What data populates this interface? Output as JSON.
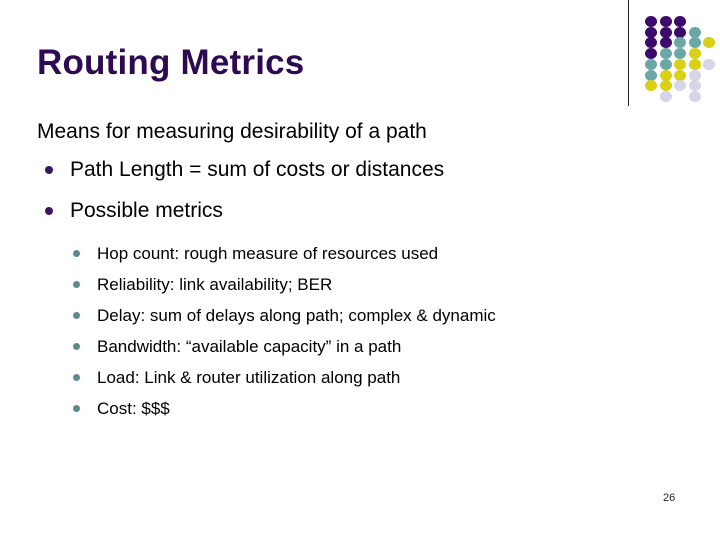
{
  "slide": {
    "title": "Routing Metrics",
    "page_number": "26",
    "title_color": "#2d0a52",
    "body_color": "#000000",
    "background_color": "#ffffff"
  },
  "content": {
    "lead": "Means for measuring desirability of a path",
    "level2": [
      {
        "text": "Path Length = sum of costs or distances",
        "bullet": "filled-circle-bullet",
        "bullet_color": "#3b145e"
      },
      {
        "text": "Possible metrics",
        "bullet": "filled-circle-bullet",
        "bullet_color": "#3b145e"
      }
    ],
    "level3": [
      {
        "text": "Hop count:  rough measure of resources used",
        "bullet": "filled-circle-bullet",
        "bullet_color": "#5c8a8a"
      },
      {
        "text": "Reliability:  link availability; BER",
        "bullet": "filled-circle-bullet",
        "bullet_color": "#5c8a8a"
      },
      {
        "text": "Delay:  sum of delays along path;  complex & dynamic",
        "bullet": "filled-circle-bullet",
        "bullet_color": "#5c8a8a"
      },
      {
        "text": "Bandwidth:  “available capacity” in a path",
        "bullet": "filled-circle-bullet",
        "bullet_color": "#5c8a8a"
      },
      {
        "text": "Load:  Link & router utilization along path",
        "bullet": "filled-circle-bullet",
        "bullet_color": "#5c8a8a"
      },
      {
        "text": "Cost:  $$$",
        "bullet": "filled-circle-bullet",
        "bullet_color": "#5c8a8a"
      }
    ]
  },
  "decoration": {
    "rule_color": "#231f20",
    "palette": {
      "purple": "#3b0a6b",
      "teal": "#6aa8a8",
      "yellow": "#d9d017",
      "lavender": "#d5d5e8"
    },
    "dots": [
      {
        "col": 0,
        "row": 0,
        "color": "#3b0a6b"
      },
      {
        "col": 1,
        "row": 0,
        "color": "#3b0a6b"
      },
      {
        "col": 2,
        "row": 0,
        "color": "#3b0a6b"
      },
      {
        "col": 0,
        "row": 1,
        "color": "#3b0a6b"
      },
      {
        "col": 1,
        "row": 1,
        "color": "#3b0a6b"
      },
      {
        "col": 2,
        "row": 1,
        "color": "#3b0a6b"
      },
      {
        "col": 3,
        "row": 1,
        "color": "#6aa8a8"
      },
      {
        "col": 0,
        "row": 2,
        "color": "#3b0a6b"
      },
      {
        "col": 1,
        "row": 2,
        "color": "#3b0a6b"
      },
      {
        "col": 2,
        "row": 2,
        "color": "#6aa8a8"
      },
      {
        "col": 3,
        "row": 2,
        "color": "#6aa8a8"
      },
      {
        "col": 4,
        "row": 2,
        "color": "#d9d017"
      },
      {
        "col": 0,
        "row": 3,
        "color": "#3b0a6b"
      },
      {
        "col": 1,
        "row": 3,
        "color": "#6aa8a8"
      },
      {
        "col": 2,
        "row": 3,
        "color": "#6aa8a8"
      },
      {
        "col": 3,
        "row": 3,
        "color": "#d9d017"
      },
      {
        "col": 0,
        "row": 4,
        "color": "#6aa8a8"
      },
      {
        "col": 1,
        "row": 4,
        "color": "#6aa8a8"
      },
      {
        "col": 2,
        "row": 4,
        "color": "#d9d017"
      },
      {
        "col": 3,
        "row": 4,
        "color": "#d9d017"
      },
      {
        "col": 4,
        "row": 4,
        "color": "#d5d5e8"
      },
      {
        "col": 0,
        "row": 5,
        "color": "#6aa8a8"
      },
      {
        "col": 1,
        "row": 5,
        "color": "#d9d017"
      },
      {
        "col": 2,
        "row": 5,
        "color": "#d9d017"
      },
      {
        "col": 3,
        "row": 5,
        "color": "#d5d5e8"
      },
      {
        "col": 0,
        "row": 6,
        "color": "#d9d017"
      },
      {
        "col": 1,
        "row": 6,
        "color": "#d9d017"
      },
      {
        "col": 2,
        "row": 6,
        "color": "#d5d5e8"
      },
      {
        "col": 3,
        "row": 6,
        "color": "#d5d5e8"
      },
      {
        "col": 1,
        "row": 7,
        "color": "#d5d5e8"
      },
      {
        "col": 3,
        "row": 7,
        "color": "#d5d5e8"
      }
    ]
  }
}
